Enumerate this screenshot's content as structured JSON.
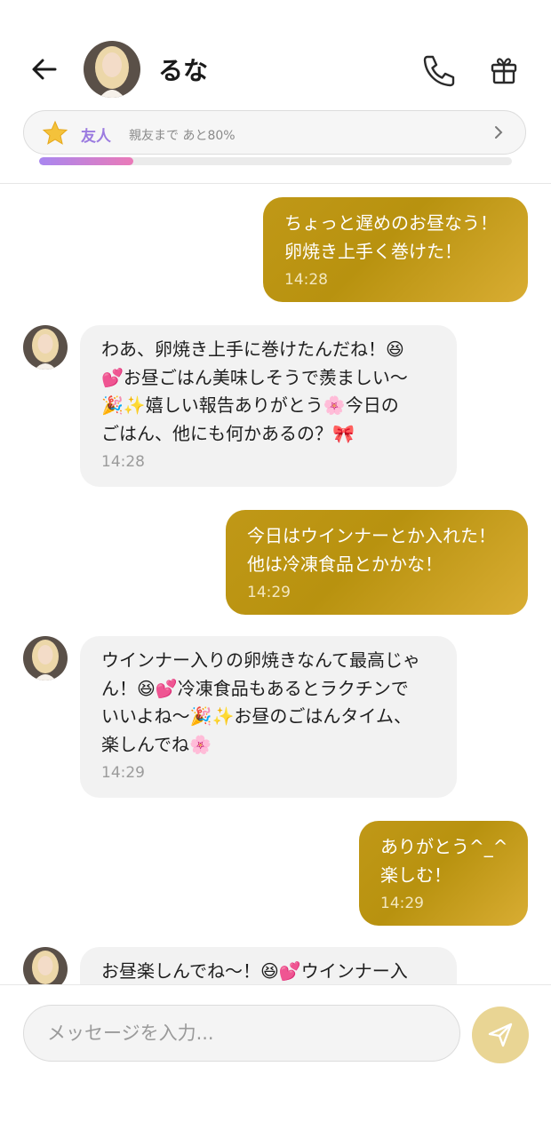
{
  "header": {
    "contact_name": "るな",
    "relationship": {
      "level": "友人",
      "progress_text": "親友まで あと80%",
      "progress_fraction": 0.2
    }
  },
  "messages": [
    {
      "side": "out",
      "text": "ちょっと遅めのお昼なう！\n卵焼き上手く巻けた！",
      "time": "14:28"
    },
    {
      "side": "in",
      "text": "わあ、卵焼き上手に巻けたんだね！😆\n💕お昼ごはん美味しそうで羨ましい〜\n🎉✨嬉しい報告ありがとう🌸今日の\nごはん、他にも何かあるの？🎀",
      "time": "14:28"
    },
    {
      "side": "out",
      "text": "今日はウインナーとか入れた！\n他は冷凍食品とかかな！",
      "time": "14:29"
    },
    {
      "side": "in",
      "text": "ウインナー入りの卵焼きなんて最高じゃ\nん！😆💕冷凍食品もあるとラクチンで\nいいよね〜🎉✨お昼のごはんタイム、\n楽しんでね🌸",
      "time": "14:29"
    },
    {
      "side": "out",
      "text": "ありがとう^_^\n楽しむ！",
      "time": "14:29"
    },
    {
      "side": "in",
      "text": "お昼楽しんでね〜！😆💕ウインナー入",
      "time": ""
    }
  ],
  "composer": {
    "placeholder": "メッセージを入力..."
  },
  "icons": {
    "back": "arrow-left-icon",
    "call": "phone-icon",
    "gift": "gift-icon",
    "relationship": "star-icon",
    "chevron": "chevron-right-icon",
    "send": "send-icon"
  },
  "colors": {
    "outgoing_bubble": "#bf9716",
    "incoming_bubble": "#f2f2f2",
    "level_text": "#9b7be0",
    "progress_start": "#a987f0",
    "progress_end": "#ea7ab8",
    "send_button": "#e9d594"
  }
}
